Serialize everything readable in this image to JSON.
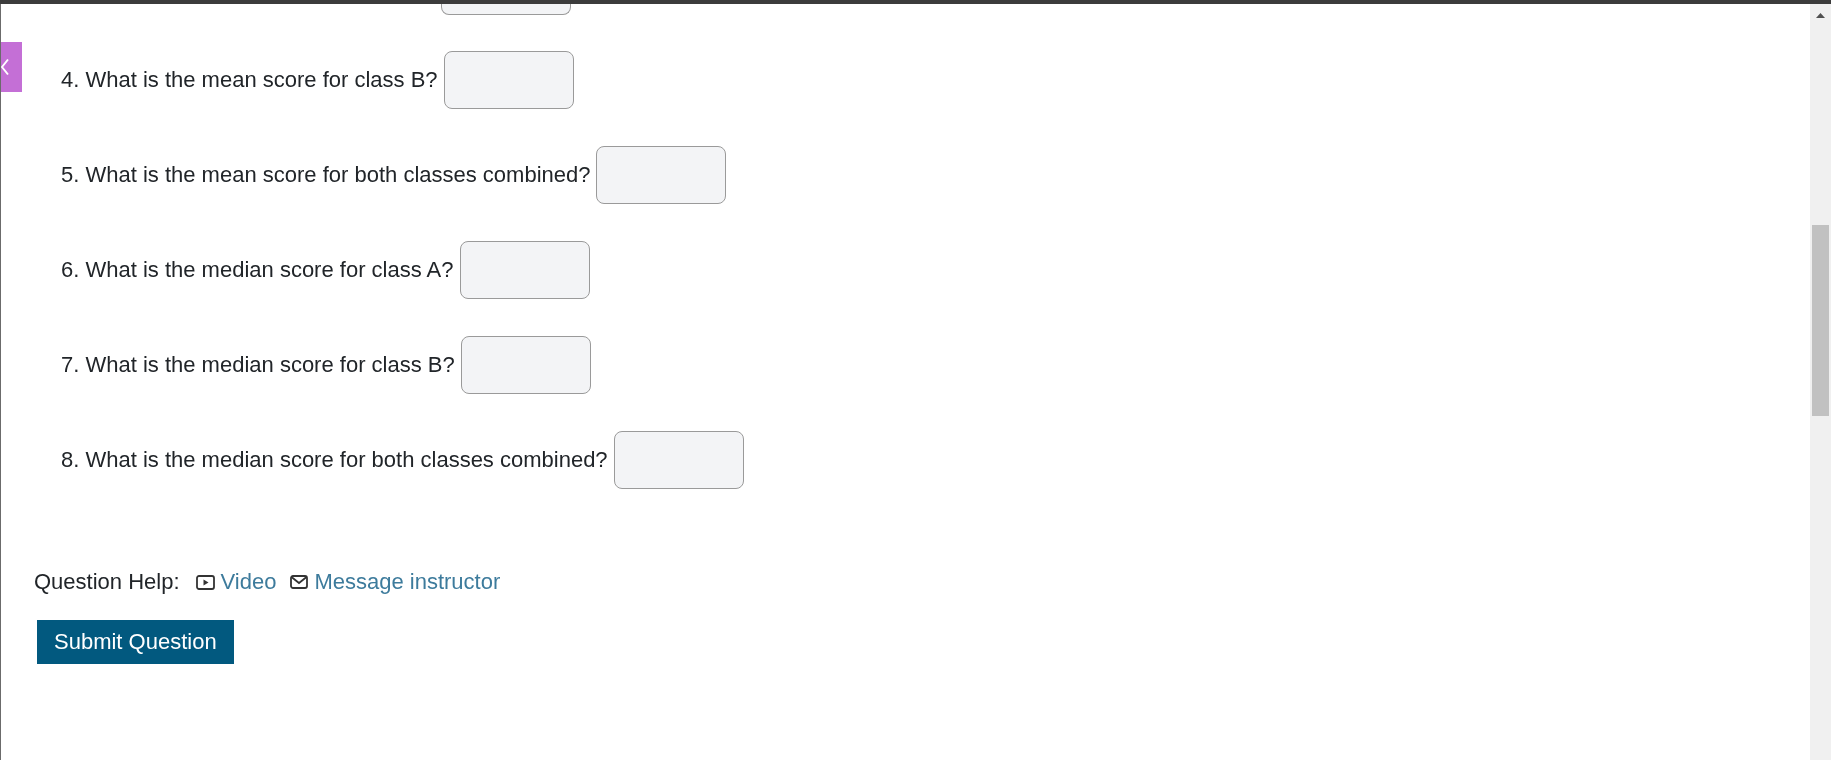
{
  "questions": [
    {
      "text": "4. What is the mean score for class B?"
    },
    {
      "text": "5. What is the mean score for both classes combined?"
    },
    {
      "text": "6. What is the median score for class A?"
    },
    {
      "text": "7. What is the median score for class B?"
    },
    {
      "text": "8. What is the median score for both classes combined?"
    }
  ],
  "question_help": {
    "label": "Question Help:",
    "links": [
      {
        "kind": "video",
        "text": "Video"
      },
      {
        "kind": "message",
        "text": "Message instructor"
      }
    ]
  },
  "submit_button": {
    "label": "Submit Question"
  }
}
